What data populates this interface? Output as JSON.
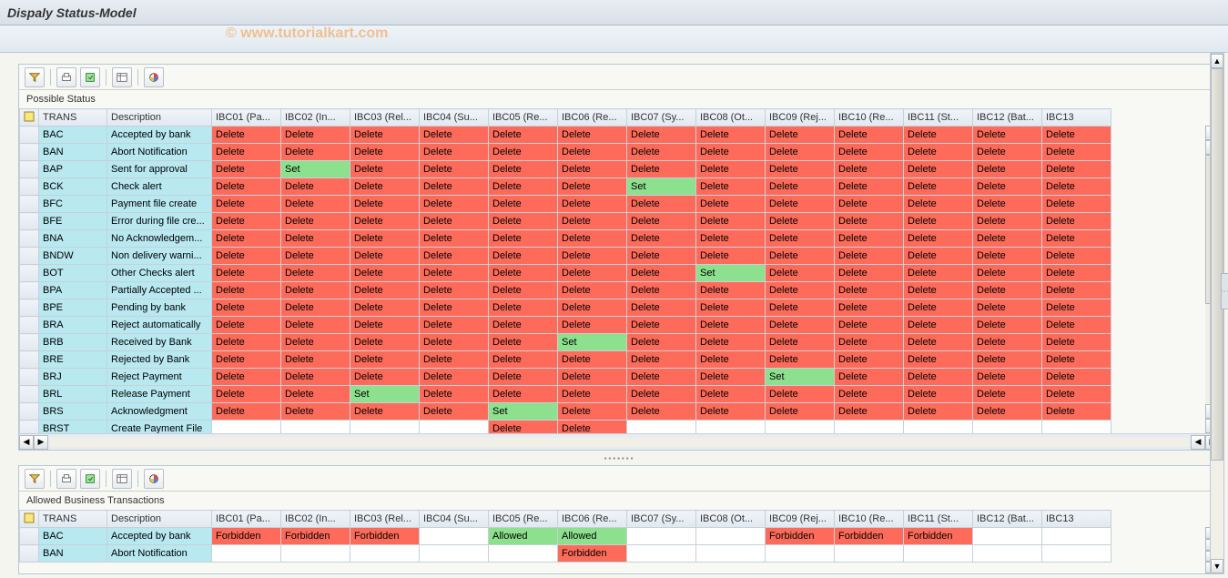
{
  "window": {
    "title": "Dispaly Status-Model"
  },
  "watermark": "© www.tutorialkart.com",
  "columns": [
    {
      "key": "trans",
      "label": "TRANS"
    },
    {
      "key": "desc",
      "label": "Description"
    },
    {
      "key": "ibc01",
      "label": "IBC01 (Pa..."
    },
    {
      "key": "ibc02",
      "label": "IBC02 (In..."
    },
    {
      "key": "ibc03",
      "label": "IBC03 (Rel..."
    },
    {
      "key": "ibc04",
      "label": "IBC04 (Su..."
    },
    {
      "key": "ibc05",
      "label": "IBC05 (Re..."
    },
    {
      "key": "ibc06",
      "label": "IBC06 (Re..."
    },
    {
      "key": "ibc07",
      "label": "IBC07 (Sy..."
    },
    {
      "key": "ibc08",
      "label": "IBC08 (Ot..."
    },
    {
      "key": "ibc09",
      "label": "IBC09 (Rej..."
    },
    {
      "key": "ibc10",
      "label": "IBC10 (Re..."
    },
    {
      "key": "ibc11",
      "label": "IBC11 (St..."
    },
    {
      "key": "ibc12",
      "label": "IBC12 (Bat..."
    },
    {
      "key": "ibc13",
      "label": "IBC13"
    }
  ],
  "panels": {
    "top": {
      "label": "Possible Status",
      "rows": [
        {
          "trans": "BAC",
          "desc": "Accepted by bank",
          "c": [
            "Delete",
            "Delete",
            "Delete",
            "Delete",
            "Delete",
            "Delete",
            "Delete",
            "Delete",
            "Delete",
            "Delete",
            "Delete",
            "Delete",
            "Delete"
          ]
        },
        {
          "trans": "BAN",
          "desc": "Abort Notification",
          "c": [
            "Delete",
            "Delete",
            "Delete",
            "Delete",
            "Delete",
            "Delete",
            "Delete",
            "Delete",
            "Delete",
            "Delete",
            "Delete",
            "Delete",
            "Delete"
          ]
        },
        {
          "trans": "BAP",
          "desc": "Sent for approval",
          "c": [
            "Delete",
            "Set",
            "Delete",
            "Delete",
            "Delete",
            "Delete",
            "Delete",
            "Delete",
            "Delete",
            "Delete",
            "Delete",
            "Delete",
            "Delete"
          ]
        },
        {
          "trans": "BCK",
          "desc": "Check alert",
          "c": [
            "Delete",
            "Delete",
            "Delete",
            "Delete",
            "Delete",
            "Delete",
            "Set",
            "Delete",
            "Delete",
            "Delete",
            "Delete",
            "Delete",
            "Delete"
          ]
        },
        {
          "trans": "BFC",
          "desc": "Payment file create",
          "c": [
            "Delete",
            "Delete",
            "Delete",
            "Delete",
            "Delete",
            "Delete",
            "Delete",
            "Delete",
            "Delete",
            "Delete",
            "Delete",
            "Delete",
            "Delete"
          ]
        },
        {
          "trans": "BFE",
          "desc": "Error during file cre...",
          "c": [
            "Delete",
            "Delete",
            "Delete",
            "Delete",
            "Delete",
            "Delete",
            "Delete",
            "Delete",
            "Delete",
            "Delete",
            "Delete",
            "Delete",
            "Delete"
          ]
        },
        {
          "trans": "BNA",
          "desc": "No Acknowledgem...",
          "c": [
            "Delete",
            "Delete",
            "Delete",
            "Delete",
            "Delete",
            "Delete",
            "Delete",
            "Delete",
            "Delete",
            "Delete",
            "Delete",
            "Delete",
            "Delete"
          ]
        },
        {
          "trans": "BNDW",
          "desc": "Non delivery warni...",
          "c": [
            "Delete",
            "Delete",
            "Delete",
            "Delete",
            "Delete",
            "Delete",
            "Delete",
            "Delete",
            "Delete",
            "Delete",
            "Delete",
            "Delete",
            "Delete"
          ]
        },
        {
          "trans": "BOT",
          "desc": "Other Checks alert",
          "c": [
            "Delete",
            "Delete",
            "Delete",
            "Delete",
            "Delete",
            "Delete",
            "Delete",
            "Set",
            "Delete",
            "Delete",
            "Delete",
            "Delete",
            "Delete"
          ]
        },
        {
          "trans": "BPA",
          "desc": "Partially Accepted ...",
          "c": [
            "Delete",
            "Delete",
            "Delete",
            "Delete",
            "Delete",
            "Delete",
            "Delete",
            "Delete",
            "Delete",
            "Delete",
            "Delete",
            "Delete",
            "Delete"
          ]
        },
        {
          "trans": "BPE",
          "desc": "Pending by bank",
          "c": [
            "Delete",
            "Delete",
            "Delete",
            "Delete",
            "Delete",
            "Delete",
            "Delete",
            "Delete",
            "Delete",
            "Delete",
            "Delete",
            "Delete",
            "Delete"
          ]
        },
        {
          "trans": "BRA",
          "desc": "Reject automatically",
          "c": [
            "Delete",
            "Delete",
            "Delete",
            "Delete",
            "Delete",
            "Delete",
            "Delete",
            "Delete",
            "Delete",
            "Delete",
            "Delete",
            "Delete",
            "Delete"
          ]
        },
        {
          "trans": "BRB",
          "desc": "Received by Bank",
          "c": [
            "Delete",
            "Delete",
            "Delete",
            "Delete",
            "Delete",
            "Set",
            "Delete",
            "Delete",
            "Delete",
            "Delete",
            "Delete",
            "Delete",
            "Delete"
          ]
        },
        {
          "trans": "BRE",
          "desc": "Rejected by Bank",
          "c": [
            "Delete",
            "Delete",
            "Delete",
            "Delete",
            "Delete",
            "Delete",
            "Delete",
            "Delete",
            "Delete",
            "Delete",
            "Delete",
            "Delete",
            "Delete"
          ]
        },
        {
          "trans": "BRJ",
          "desc": "Reject Payment",
          "c": [
            "Delete",
            "Delete",
            "Delete",
            "Delete",
            "Delete",
            "Delete",
            "Delete",
            "Delete",
            "Set",
            "Delete",
            "Delete",
            "Delete",
            "Delete"
          ]
        },
        {
          "trans": "BRL",
          "desc": "Release Payment",
          "c": [
            "Delete",
            "Delete",
            "Set",
            "Delete",
            "Delete",
            "Delete",
            "Delete",
            "Delete",
            "Delete",
            "Delete",
            "Delete",
            "Delete",
            "Delete"
          ]
        },
        {
          "trans": "BRS",
          "desc": "Acknowledgment",
          "c": [
            "Delete",
            "Delete",
            "Delete",
            "Delete",
            "Set",
            "Delete",
            "Delete",
            "Delete",
            "Delete",
            "Delete",
            "Delete",
            "Delete",
            "Delete"
          ]
        },
        {
          "trans": "BRST",
          "desc": "Create Payment File",
          "c": [
            "",
            "",
            "",
            "",
            "Delete",
            "Delete",
            "",
            "",
            "",
            "",
            "",
            "",
            ""
          ]
        }
      ]
    },
    "bottom": {
      "label": "Allowed Business Transactions",
      "rows": [
        {
          "trans": "BAC",
          "desc": "Accepted by bank",
          "c": [
            "Forbidden",
            "Forbidden",
            "Forbidden",
            "",
            "Allowed",
            "Allowed",
            "",
            "",
            "Forbidden",
            "Forbidden",
            "Forbidden",
            "",
            ""
          ]
        },
        {
          "trans": "BAN",
          "desc": "Abort Notification",
          "c": [
            "",
            "",
            "",
            "",
            "",
            "Forbidden",
            "",
            "",
            "",
            "",
            "",
            "",
            ""
          ]
        }
      ]
    }
  },
  "cellStyles": {
    "Delete": "cell-delete",
    "Set": "cell-set",
    "Forbidden": "cell-forbidden",
    "Allowed": "cell-allowed",
    "": "cell-empty"
  }
}
